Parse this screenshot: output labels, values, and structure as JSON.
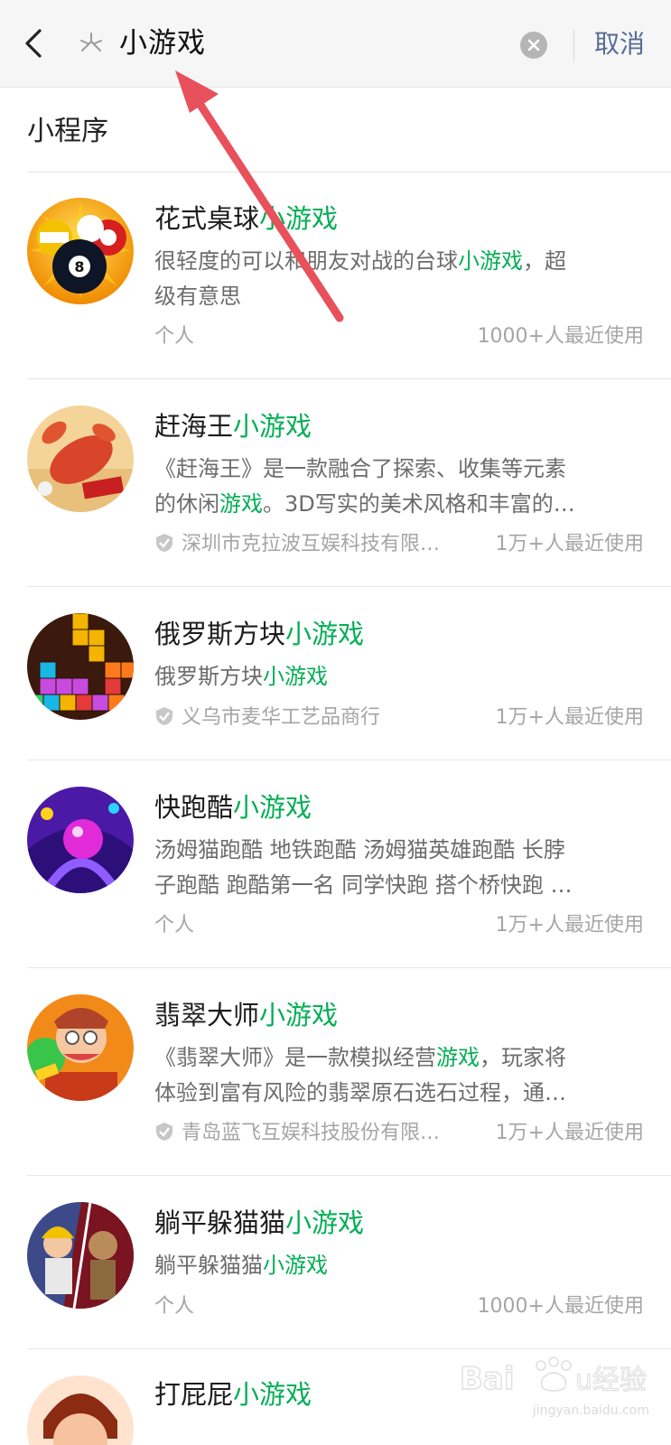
{
  "header": {
    "query": "小游戏",
    "cancel_label": "取消"
  },
  "section": {
    "title": "小程序"
  },
  "results": [
    {
      "title_prefix": "花式桌球",
      "title_highlight": "小游戏",
      "desc_line1_a": "很轻度的可以和朋友对战的台球",
      "desc_line1_hl": "小游戏",
      "desc_line1_b": "，超",
      "desc_line2": "级有意思",
      "owner": "个人",
      "usage": "1000+人最近使用"
    },
    {
      "title_prefix": "赶海王",
      "title_highlight": "小游戏",
      "desc_line1": "《赶海王》是一款融合了探索、收集等元素",
      "desc_line2_a": "的休闲",
      "desc_line2_hl": "游戏",
      "desc_line2_b": "。3D写实的美术风格和丰富的…",
      "owner": "深圳市克拉波互娱科技有限…",
      "usage": "1万+人最近使用"
    },
    {
      "title_prefix": "俄罗斯方块",
      "title_highlight": "小游戏",
      "desc_a": "俄罗斯方块",
      "desc_hl": "小游戏",
      "owner": "义乌市麦华工艺品商行",
      "usage": "1万+人最近使用"
    },
    {
      "title_prefix": "快跑酷",
      "title_highlight": "小游戏",
      "desc_line1": "汤姆猫跑酷 地铁跑酷 汤姆猫英雄跑酷 长脖",
      "desc_line2": "子跑酷 跑酷第一名 同学快跑 搭个桥快跑 …",
      "owner": "个人",
      "usage": "1万+人最近使用"
    },
    {
      "title_prefix": "翡翠大师",
      "title_highlight": "小游戏",
      "desc_line1_a": "《翡翠大师》是一款模拟经营",
      "desc_line1_hl": "游戏",
      "desc_line1_b": "，玩家将",
      "desc_line2": "体验到富有风险的翡翠原石选石过程，通…",
      "owner": "青岛蓝飞互娱科技股份有限…",
      "usage": "1万+人最近使用"
    },
    {
      "title_prefix": "躺平躲猫猫",
      "title_highlight": "小游戏",
      "desc_a": "躺平躲猫猫",
      "desc_hl": "小游戏",
      "owner": "个人",
      "usage": "1000+人最近使用"
    },
    {
      "title_prefix": "打屁屁",
      "title_highlight": "小游戏"
    }
  ],
  "icons": {
    "back": "chevron-left-icon",
    "star": "star-outline-icon",
    "clear": "clear-circle-icon",
    "verified": "verified-shield-icon"
  },
  "colors": {
    "highlight": "#06ae56",
    "cancel": "#576b95",
    "annotation_arrow": "#e8505b"
  },
  "watermark": {
    "brand": "Baidu经验",
    "domain": "jingyan.baidu.com"
  }
}
